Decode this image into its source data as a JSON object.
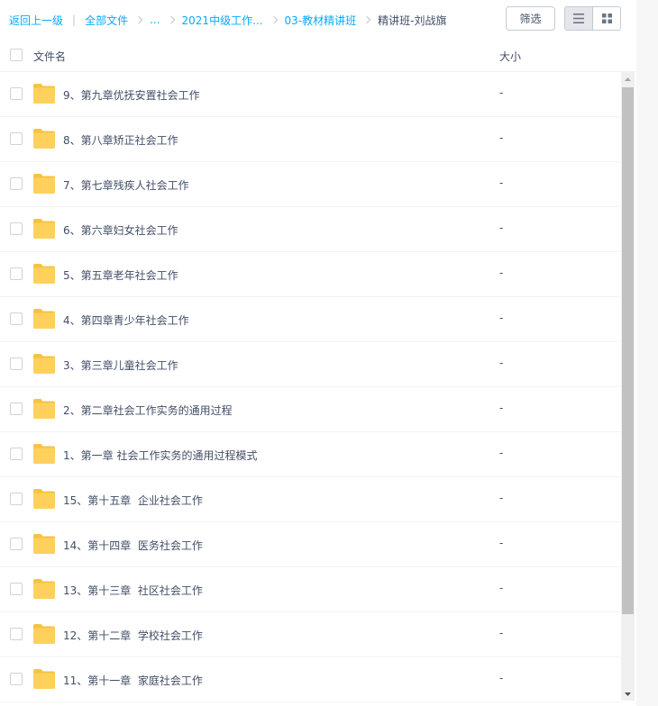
{
  "breadcrumb": {
    "back": "返回上一级",
    "separator": "|",
    "all_files": "全部文件",
    "ellipsis": "...",
    "level1": "2021中级工作...",
    "level2": "03-教材精讲班",
    "current": "精讲班-刘战旗"
  },
  "toolbar": {
    "filter_label": "筛选",
    "view_mode": "list"
  },
  "list_header": {
    "name": "文件名",
    "size": "大小"
  },
  "files": [
    {
      "name": "9、第九章优抚安置社会工作",
      "size": "-"
    },
    {
      "name": "8、第八章矫正社会工作",
      "size": "-"
    },
    {
      "name": "7、第七章残疾人社会工作",
      "size": "-"
    },
    {
      "name": "6、第六章妇女社会工作",
      "size": "-"
    },
    {
      "name": "5、第五章老年社会工作",
      "size": "-"
    },
    {
      "name": "4、第四章青少年社会工作",
      "size": "-"
    },
    {
      "name": "3、第三章儿童社会工作",
      "size": "-"
    },
    {
      "name": "2、第二章社会工作实务的通用过程",
      "size": "-"
    },
    {
      "name": "1、第一章 社会工作实务的通用过程模式",
      "size": "-"
    },
    {
      "name": "15、第十五章  企业社会工作",
      "size": "-"
    },
    {
      "name": "14、第十四章  医务社会工作",
      "size": "-"
    },
    {
      "name": "13、第十三章  社区社会工作",
      "size": "-"
    },
    {
      "name": "12、第十二章  学校社会工作",
      "size": "-"
    },
    {
      "name": "11、第十一章  家庭社会工作",
      "size": "-"
    }
  ],
  "icons": {
    "folder": "folder-icon",
    "list_view": "list-view-icon",
    "grid_view": "grid-view-icon"
  },
  "colors": {
    "link": "#09aaff",
    "folder": "#ffd15c",
    "text": "#424e67"
  }
}
